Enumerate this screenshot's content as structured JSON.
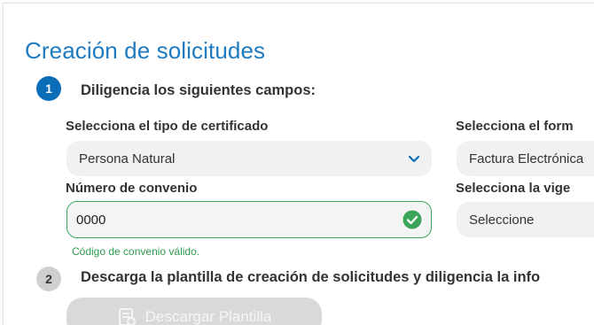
{
  "page": {
    "title": "Creación de solicitudes"
  },
  "step1": {
    "number": "1",
    "text": "Diligencia los siguientes campos:",
    "certificate_type": {
      "label": "Selecciona el tipo de certificado",
      "value": "Persona Natural"
    },
    "format": {
      "label": "Selecciona el form",
      "value": "Factura Electrónica"
    },
    "agreement": {
      "label": "Número de convenio",
      "value": "0000",
      "hint": "Código de convenio válido."
    },
    "validity": {
      "label": "Selecciona la vige",
      "value": "Seleccione"
    }
  },
  "step2": {
    "number": "2",
    "text": "Descarga la plantilla de creación de solicitudes y diligencia la info",
    "download_label": "Descargar Plantilla"
  },
  "colors": {
    "accent": "#0b6cb8",
    "title": "#1f7bc0",
    "valid": "#3aa55a"
  },
  "icons": [
    "chevron-down-icon",
    "check-circle-icon",
    "spreadsheet-icon"
  ]
}
